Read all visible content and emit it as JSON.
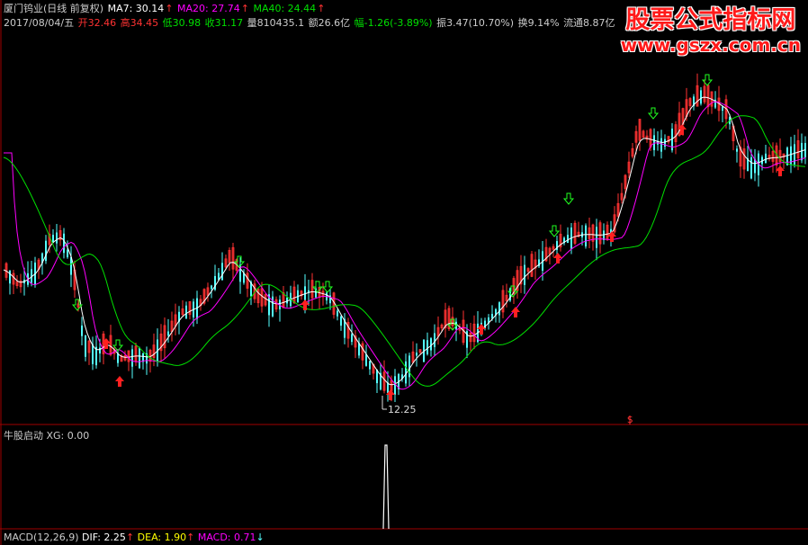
{
  "header": {
    "stock_name": "厦门钨业(日线 前复权)",
    "ma7_label": "MA7: 30.14",
    "ma20_label": "MA20: 27.74",
    "ma40_label": "MA40: 24.44",
    "date": "2017/08/04/五",
    "open": "开32.46",
    "high": "高34.45",
    "low": "低30.98",
    "close": "收31.17",
    "volume": "量810435.1",
    "amount": "额26.6亿",
    "change": "幅-1.26(-3.89%)",
    "amplitude": "振3.47(10.70%)",
    "turnover": "换9.14%",
    "float": "流通8.87亿"
  },
  "annotations": {
    "low_price": "12.25",
    "s_marker": "S"
  },
  "indicator": {
    "title": "牛股启动 XG: 0.00"
  },
  "macd": {
    "name": "MACD(12,26,9)",
    "dif": "DIF: 2.25",
    "dea": "DEA: 1.90",
    "macd": "MACD: 0.71"
  },
  "watermark": {
    "title": "股票公式指标网",
    "url": "www.gszx.com.cn"
  },
  "colors": {
    "up": "#ff3232",
    "down": "#54ffff",
    "ma7": "#ffffff",
    "ma20": "#ff00ff",
    "ma40": "#00e000",
    "buy_arrow": "#ff2020",
    "sell_arrow": "#20ff20",
    "label_yellow": "#ffff00"
  }
}
